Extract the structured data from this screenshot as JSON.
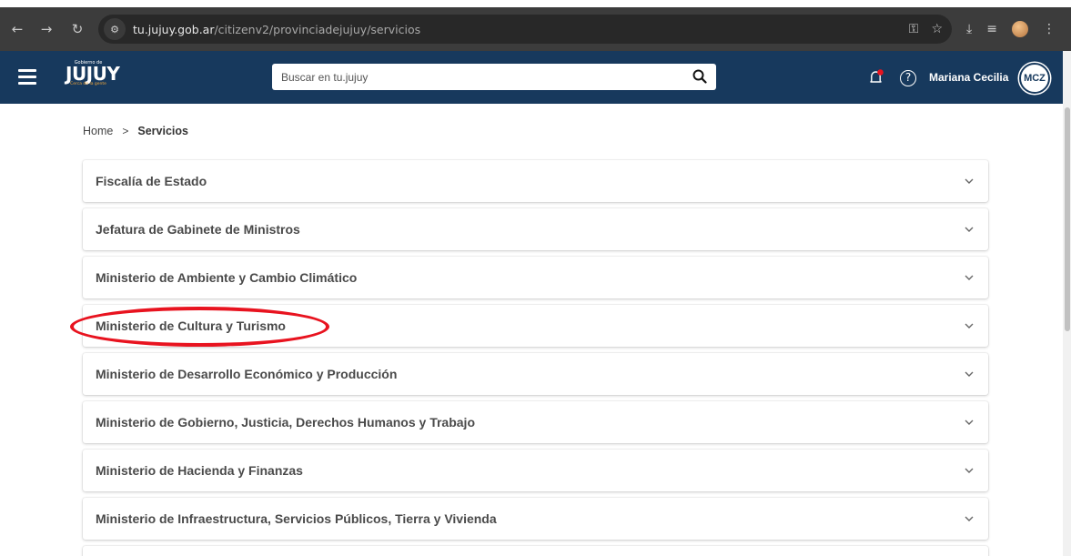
{
  "browser": {
    "url_host": "tu.jujuy.gob.ar",
    "url_path": "/citizenv2/provinciadejujuy/servicios",
    "back_icon": "arrow-left-icon",
    "forward_icon": "arrow-right-icon",
    "reload_icon": "reload-icon"
  },
  "header": {
    "logo_top": "Gobierno de",
    "logo_word": "JUJUY",
    "logo_tag": "Cerca de la gente",
    "search_placeholder": "Buscar en tu.jujuy",
    "help_glyph": "?",
    "user_name": "Mariana Cecilia",
    "avatar_initials": "MCZ",
    "brand_color": "#17395d",
    "notification_dot_color": "#e8131f"
  },
  "breadcrumb": {
    "home": "Home",
    "separator": ">",
    "current": "Servicios"
  },
  "services": [
    {
      "label": "Fiscalía de Estado"
    },
    {
      "label": "Jefatura de Gabinete de Ministros"
    },
    {
      "label": "Ministerio de Ambiente y Cambio Climático"
    },
    {
      "label": "Ministerio de Cultura y Turismo"
    },
    {
      "label": "Ministerio de Desarrollo Económico y Producción"
    },
    {
      "label": "Ministerio de Gobierno, Justicia, Derechos Humanos y Trabajo"
    },
    {
      "label": "Ministerio de Hacienda y Finanzas"
    },
    {
      "label": "Ministerio de Infraestructura, Servicios Públicos, Tierra y Vivienda"
    }
  ],
  "annotation": {
    "highlighted_item": "Ministerio de Cultura y Turismo",
    "color": "#e8131f"
  }
}
